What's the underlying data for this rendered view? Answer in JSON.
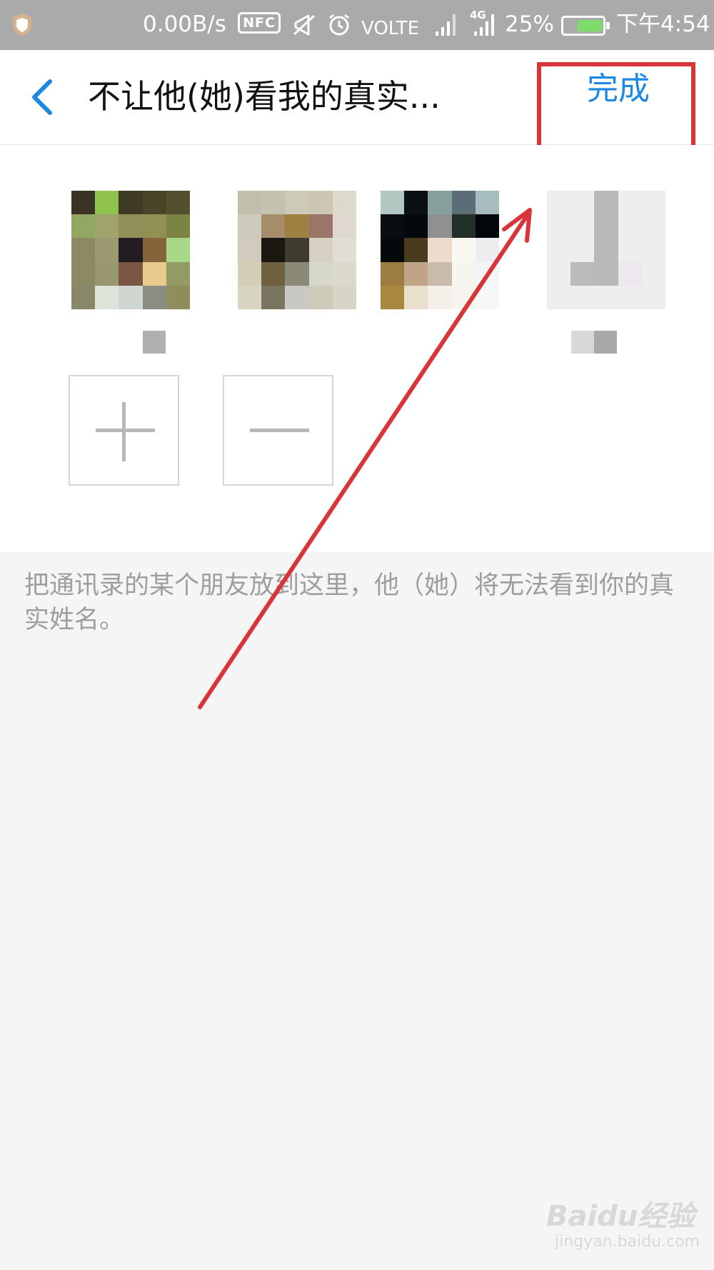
{
  "status_bar": {
    "speed": "0.00B/s",
    "nfc": "NFC",
    "volte": "VOLTE",
    "network": "4G",
    "battery": "25%",
    "battery_level": 0.25,
    "time": "下午4:54"
  },
  "header": {
    "title": "不让他(她)看我的真实...",
    "done_label": "完成"
  },
  "members": [
    {
      "colors": [
        "#3a3224",
        "#8fc34d",
        "#3f3a24",
        "#4a4528",
        "#53502d",
        "#92a862",
        "#a0a36c",
        "#8f9159",
        "#919156",
        "#7b8443",
        "#8b8a62",
        "#9c9872",
        "#231c22",
        "#84643a",
        "#a7d887",
        "#8b8a63",
        "#99976f",
        "#7a5542",
        "#e8cb8d",
        "#949a63",
        "#89876a",
        "#dee3da",
        "#cfd7d3",
        "#8a8d83",
        "#8f8d5c"
      ]
    },
    {
      "colors": [
        "#c0bfae",
        "#c4c1ae",
        "#cecab8",
        "#cbc7b4",
        "#dbdacd",
        "#cfcbbc",
        "#a58d6c",
        "#a08040",
        "#9b7569",
        "#ded8d1",
        "#d2cbbd",
        "#1a1710",
        "#3f3b2f",
        "#d8d0c0",
        "#e0ddd5",
        "#d4cdb8",
        "#6f6140",
        "#8a8a77",
        "#d6d9c9",
        "#dcd9cb",
        "#d8d6c3",
        "#7a7560",
        "#c9c8c3",
        "#cecbb9",
        "#d8d5c6"
      ]
    },
    {
      "colors": [
        "#b3c8c3",
        "#0b1015",
        "#86a09c",
        "#5d6d78",
        "#a6bcbe",
        "#0a0d12",
        "#06090c",
        "#909090",
        "#233029",
        "#03060a",
        "#06090c",
        "#483a1e",
        "#eedbcc",
        "#f9f7f2",
        "#eeedf0",
        "#9d7c43",
        "#bfa586",
        "#c9bbab",
        "#f7f5f0",
        "#f5f5f7",
        "#a8883e",
        "#e9dfcc",
        "#f4efe8",
        "#f6f4ef",
        "#f7f7f9"
      ]
    },
    {
      "colors": [
        "#eeeeee",
        "#eeeeee",
        "#b9b9b9",
        "#eeeeee",
        "#eeeeee",
        "#eeeeee",
        "#eeeeee",
        "#b9b9b9",
        "#eeeeee",
        "#eeeeee",
        "#eeeeee",
        "#eeeeee",
        "#b9b9b9",
        "#eeeeee",
        "#eeeeee",
        "#eeeeee",
        "#bbbbbb",
        "#b9b9b9",
        "#ede8ed",
        "#eeeeee",
        "#eeeeee",
        "#eeeeee",
        "#eeeeee",
        "#eeeeee",
        "#eeeeee"
      ]
    }
  ],
  "hint": "把通讯录的某个朋友放到这里，他（她）将无法看到你的真实姓名。",
  "watermark": {
    "brand": "Baidu经验",
    "url": "jingyan.baidu.com"
  },
  "colors": {
    "accent": "#1e88e5",
    "annotation": "#d8353a",
    "status_bar": "#aaaaaa"
  }
}
